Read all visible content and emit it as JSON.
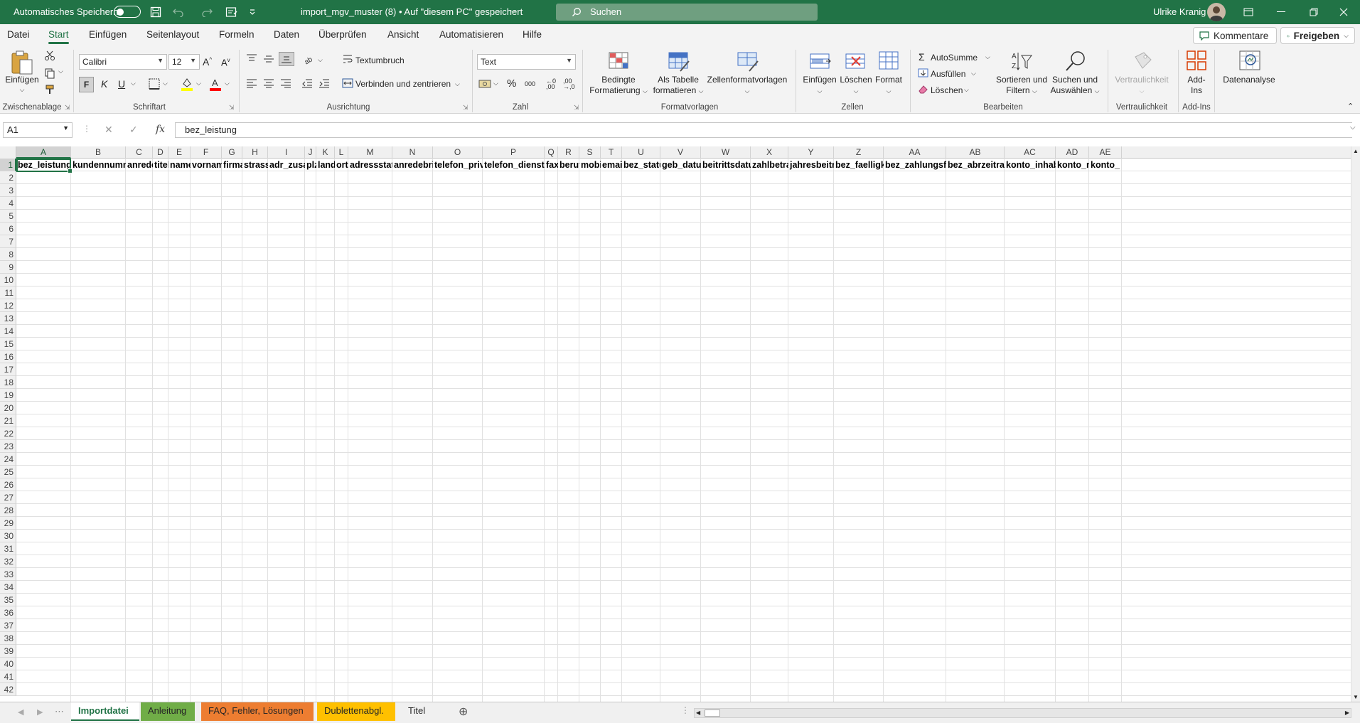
{
  "titlebar": {
    "autosave_label": "Automatisches Speichern",
    "doc_title": "import_mgv_muster (8)  •  Auf \"diesem PC\" gespeichert",
    "search_placeholder": "Suchen",
    "user_name": "Ulrike Kranig",
    "bg_color": "#217346"
  },
  "ribbon_tabs": [
    "Datei",
    "Start",
    "Einfügen",
    "Seitenlayout",
    "Formeln",
    "Daten",
    "Überprüfen",
    "Ansicht",
    "Automatisieren",
    "Hilfe"
  ],
  "active_tab": "Start",
  "top_buttons": {
    "comments": "Kommentare",
    "share": "Freigeben"
  },
  "ribbon": {
    "clipboard": {
      "paste": "Einfügen",
      "group": "Zwischenablage"
    },
    "font": {
      "name": "Calibri",
      "size": "12",
      "bold": "F",
      "italic": "K",
      "underline": "U",
      "group": "Schriftart"
    },
    "alignment": {
      "wrap": "Textumbruch",
      "merge": "Verbinden und zentrieren",
      "group": "Ausrichtung"
    },
    "number": {
      "format": "Text",
      "group": "Zahl"
    },
    "styles": {
      "conditional_1": "Bedingte",
      "conditional_2": "Formatierung",
      "table_1": "Als Tabelle",
      "table_2": "formatieren",
      "cellstyles": "Zellenformatvorlagen",
      "group": "Formatvorlagen"
    },
    "cells": {
      "insert": "Einfügen",
      "delete": "Löschen",
      "format": "Format",
      "group": "Zellen"
    },
    "editing": {
      "autosum": "AutoSumme",
      "fill": "Ausfüllen",
      "clear": "Löschen",
      "sort_1": "Sortieren und",
      "sort_2": "Filtern",
      "find_1": "Suchen und",
      "find_2": "Auswählen",
      "group": "Bearbeiten"
    },
    "sensitivity": {
      "label": "Vertraulichkeit",
      "group": "Vertraulichkeit"
    },
    "addins": {
      "label_1": "Add-",
      "label_2": "Ins",
      "group": "Add-Ins"
    },
    "analysis": {
      "label": "Datenanalyse"
    }
  },
  "formula_bar": {
    "name_box": "A1",
    "fx": "fx",
    "content": "bez_leistung"
  },
  "columns": [
    "A",
    "B",
    "C",
    "D",
    "E",
    "F",
    "G",
    "H",
    "I",
    "J",
    "K",
    "L",
    "M",
    "N",
    "O",
    "P",
    "Q",
    "R",
    "S",
    "T",
    "U",
    "V",
    "W",
    "X",
    "Y",
    "Z",
    "AA",
    "AB",
    "AC",
    "AD",
    "AE"
  ],
  "header_row": [
    "bez_leistung",
    "kundennummer",
    "anrede",
    "titel",
    "name",
    "vorname",
    "firma",
    "strasse",
    "adr_zusatz",
    "plz",
    "land",
    "ort",
    "adressstatus",
    "anredebrief",
    "telefon_privat",
    "telefon_dienstlich",
    "fax",
    "beruf",
    "mobil",
    "email",
    "bez_status",
    "geb_datum",
    "beitrittsdatum",
    "zahlbetrag",
    "jahresbeitrag",
    "bez_faelligkeit",
    "bez_zahlungsform",
    "bez_abrzeitraum",
    "konto_inhaber",
    "konto_nr",
    "konto_"
  ],
  "row_numbers": [
    "1",
    "2",
    "3",
    "4",
    "5",
    "6",
    "7",
    "8",
    "9",
    "10",
    "11",
    "12",
    "13",
    "14",
    "15",
    "16",
    "17",
    "18",
    "19",
    "20",
    "21",
    "22",
    "23",
    "24",
    "25",
    "26",
    "27",
    "28",
    "29",
    "30",
    "31",
    "32",
    "33",
    "34",
    "35",
    "36",
    "37",
    "38",
    "39",
    "40",
    "41",
    "42"
  ],
  "sheet_tabs": [
    {
      "label": "Importdatei",
      "color": "#ffffff",
      "active": true
    },
    {
      "label": "Anleitung",
      "color": "#70ad47",
      "active": false
    },
    {
      "label": "FAQ, Fehler, Lösungen",
      "color": "#ed7d31",
      "active": false
    },
    {
      "label": "Dublettenabgl.",
      "color": "#ffc000",
      "active": false
    },
    {
      "label": "Titel",
      "color": "#f0f0f0",
      "active": false
    }
  ]
}
